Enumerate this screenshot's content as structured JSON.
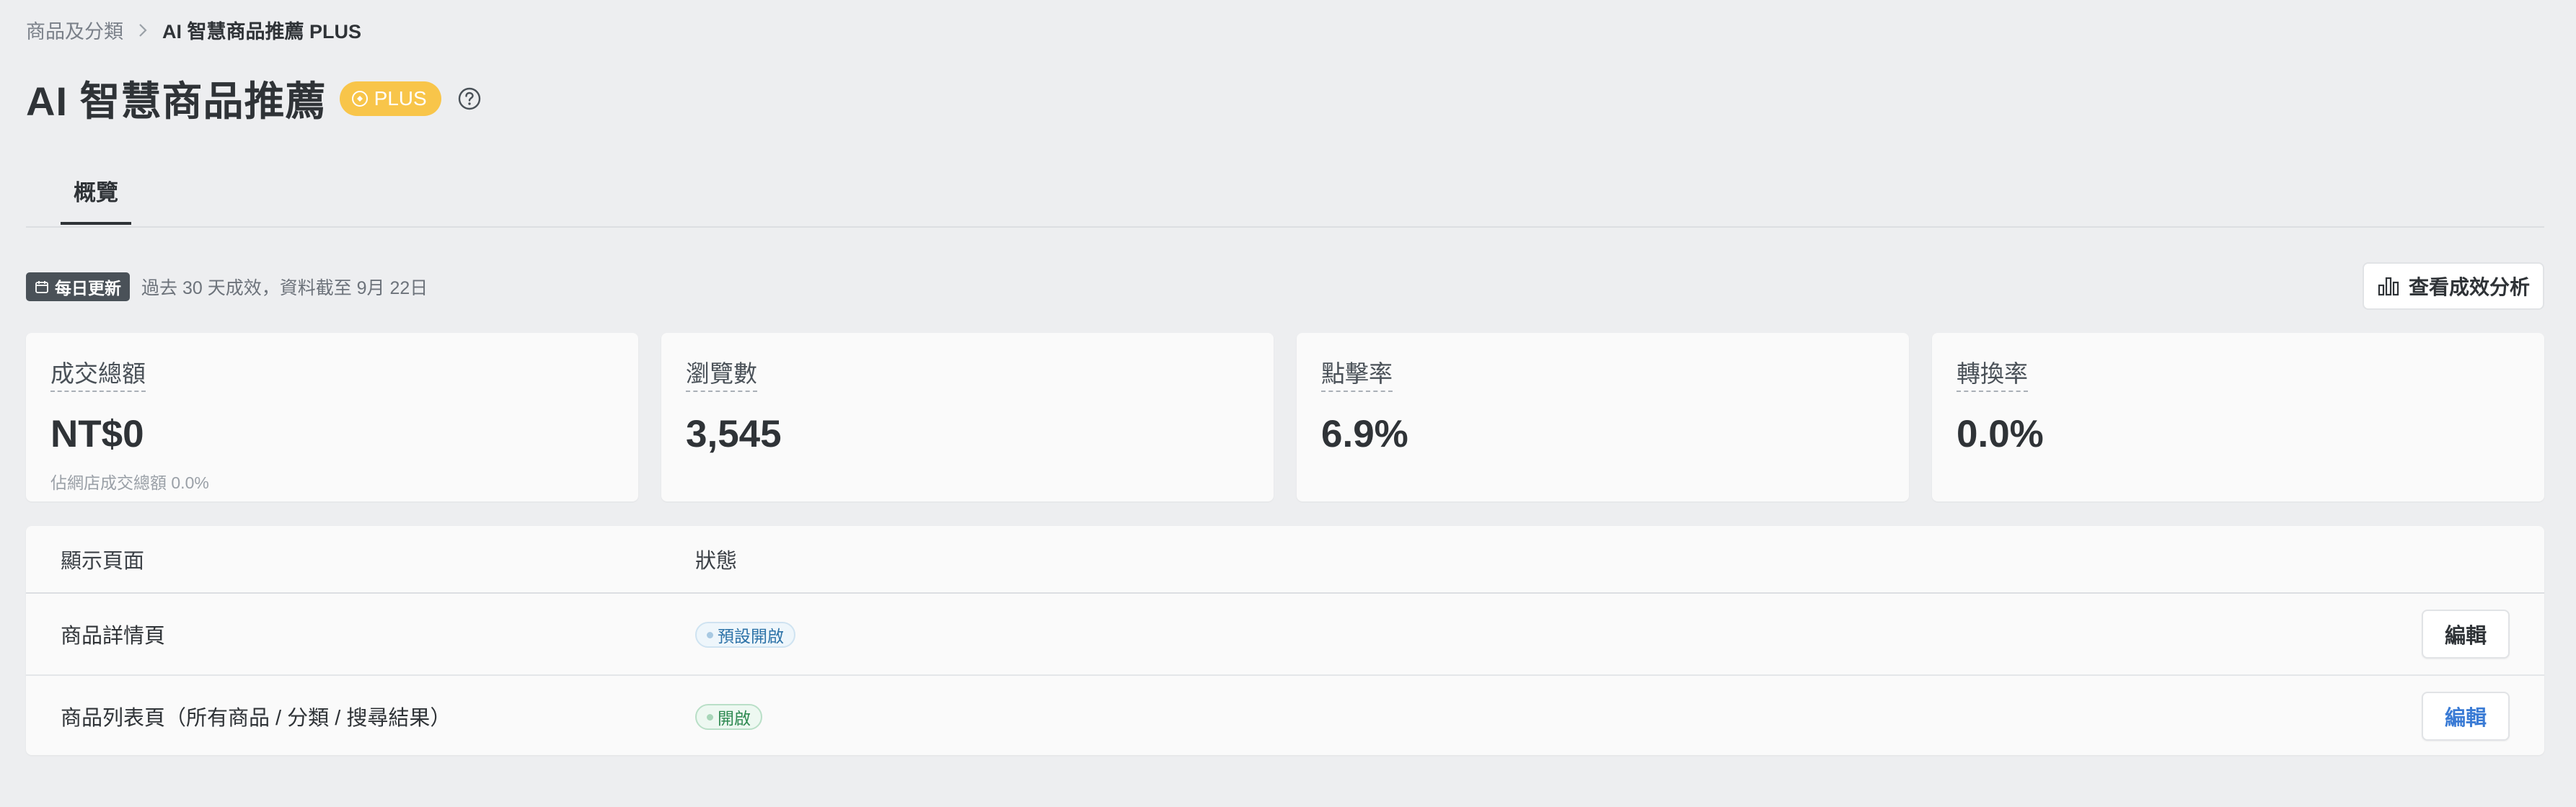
{
  "breadcrumb": {
    "parent": "商品及分類",
    "current": "AI 智慧商品推薦 PLUS"
  },
  "header": {
    "title": "AI 智慧商品推薦",
    "badge": "PLUS"
  },
  "tabs": [
    {
      "label": "概覽",
      "active": true
    }
  ],
  "update": {
    "badge": "每日更新",
    "text": "過去 30 天成效，資料截至 9月 22日"
  },
  "analysis_button": "查看成效分析",
  "metrics": [
    {
      "label": "成交總額",
      "value": "NT$0",
      "sub": "佔網店成交總額 0.0%"
    },
    {
      "label": "瀏覽數",
      "value": "3,545"
    },
    {
      "label": "點擊率",
      "value": "6.9%"
    },
    {
      "label": "轉換率",
      "value": "0.0%"
    }
  ],
  "table": {
    "headers": {
      "page": "顯示頁面",
      "status": "狀態"
    },
    "rows": [
      {
        "page": "商品詳情頁",
        "status": "預設開啟",
        "action": "編輯"
      },
      {
        "page": "商品列表頁（所有商品 / 分類 / 搜尋結果）",
        "status": "開啟",
        "action": "編輯"
      }
    ]
  },
  "colors": {
    "background": "#edeef0",
    "plus_badge": "#f8c54a",
    "status_default": "#2d73a8",
    "status_on": "#2f8a52",
    "link_blue": "#3a7bd5"
  }
}
